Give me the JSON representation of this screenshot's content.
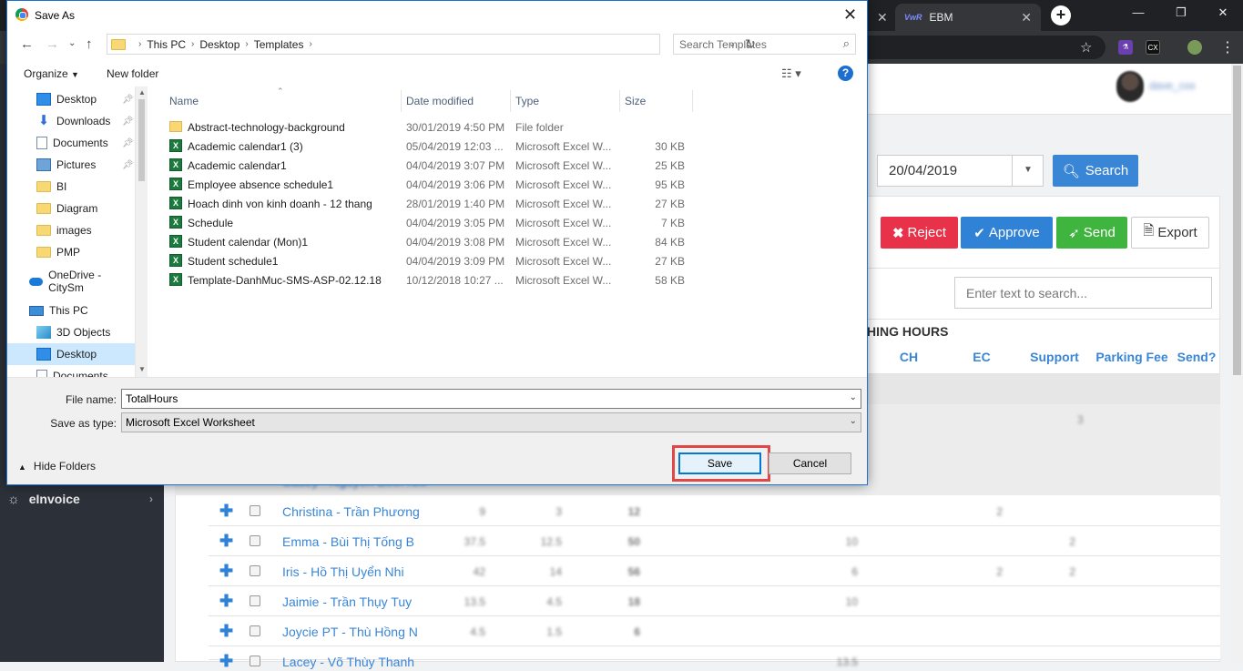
{
  "browser": {
    "tab_label": "EBM",
    "tab_logo_text": "VwR",
    "new_tab_symbol": "+",
    "ext_label": "CX"
  },
  "app": {
    "user_name": "dave_cxx",
    "sidebar": {
      "item_label": "eInvoice"
    },
    "date_value": "20/04/2019",
    "buttons": {
      "search": "Search",
      "reject": "Reject",
      "approve": "Approve",
      "send": "Send",
      "export": "Export"
    },
    "search_placeholder": "Enter text to search...",
    "group_header": "HING HOURS",
    "columns": [
      "CH",
      "EC",
      "Support",
      "Parking Fee",
      "Send?"
    ],
    "band_value": "3",
    "partial_row_name": "Casey - Nguyễn Bình Nhi",
    "rows": [
      {
        "name": "Christina - Trần Phương",
        "c1": "9",
        "c2": "3",
        "c3": "12",
        "c4": "",
        "c5": "2",
        "c6": ""
      },
      {
        "name": "Emma - Bùi Thị Tống B",
        "c1": "37.5",
        "c2": "12.5",
        "c3": "50",
        "c4": "10",
        "c5": "",
        "c6": "2"
      },
      {
        "name": "Iris - Hồ Thị Uyển Nhi",
        "c1": "42",
        "c2": "14",
        "c3": "56",
        "c4": "6",
        "c5": "2",
        "c6": "2"
      },
      {
        "name": "Jaimie - Trần Thụy Tuy",
        "c1": "13.5",
        "c2": "4.5",
        "c3": "18",
        "c4": "10",
        "c5": "",
        "c6": ""
      },
      {
        "name": "Joycie PT - Thù Hồng N",
        "c1": "4.5",
        "c2": "1.5",
        "c3": "6",
        "c4": "",
        "c5": "",
        "c6": ""
      },
      {
        "name": "Lacey - Võ Thùy Thanh",
        "c1": "",
        "c2": "",
        "c3": "",
        "c4": "13.5",
        "c5": "",
        "c6": ""
      }
    ]
  },
  "dialog": {
    "title": "Save As",
    "close_symbol": "✕",
    "breadcrumb": [
      "This PC",
      "Desktop",
      "Templates"
    ],
    "search_placeholder": "Search Templates",
    "toolbar": {
      "organize": "Organize",
      "new_folder": "New folder"
    },
    "nav_items": [
      {
        "label": "Desktop",
        "icon": "desktop-icon",
        "pinned": true
      },
      {
        "label": "Downloads",
        "icon": "downloads-icon",
        "pinned": true
      },
      {
        "label": "Documents",
        "icon": "documents-icon",
        "pinned": true
      },
      {
        "label": "Pictures",
        "icon": "pictures-icon",
        "pinned": true
      },
      {
        "label": "BI",
        "icon": "folder-icon",
        "pinned": false
      },
      {
        "label": "Diagram",
        "icon": "folder-icon",
        "pinned": false
      },
      {
        "label": "images",
        "icon": "folder-icon",
        "pinned": false
      },
      {
        "label": "PMP",
        "icon": "folder-icon",
        "pinned": false
      },
      {
        "label": "OneDrive - CitySm",
        "icon": "onedrive-icon",
        "pinned": false
      },
      {
        "label": "This PC",
        "icon": "this-pc-icon",
        "pinned": false
      },
      {
        "label": "3D Objects",
        "icon": "3d-objects-icon",
        "pinned": false
      },
      {
        "label": "Desktop",
        "icon": "desktop-icon",
        "pinned": false,
        "selected": true
      },
      {
        "label": "Documents",
        "icon": "documents-icon",
        "pinned": false
      }
    ],
    "columns": {
      "name": "Name",
      "date": "Date modified",
      "type": "Type",
      "size": "Size"
    },
    "files": [
      {
        "name": "Abstract-technology-background",
        "date": "30/01/2019 4:50 PM",
        "type": "File folder",
        "size": "",
        "kind": "folder"
      },
      {
        "name": "Academic calendar1 (3)",
        "date": "05/04/2019 12:03 ...",
        "type": "Microsoft Excel W...",
        "size": "30 KB",
        "kind": "excel"
      },
      {
        "name": "Academic calendar1",
        "date": "04/04/2019 3:07 PM",
        "type": "Microsoft Excel W...",
        "size": "25 KB",
        "kind": "excel"
      },
      {
        "name": "Employee absence schedule1",
        "date": "04/04/2019 3:06 PM",
        "type": "Microsoft Excel W...",
        "size": "95 KB",
        "kind": "excel"
      },
      {
        "name": "Hoach dinh von kinh doanh - 12 thang",
        "date": "28/01/2019 1:40 PM",
        "type": "Microsoft Excel W...",
        "size": "27 KB",
        "kind": "excel"
      },
      {
        "name": "Schedule",
        "date": "04/04/2019 3:05 PM",
        "type": "Microsoft Excel W...",
        "size": "7 KB",
        "kind": "excel"
      },
      {
        "name": "Student calendar (Mon)1",
        "date": "04/04/2019 3:08 PM",
        "type": "Microsoft Excel W...",
        "size": "84 KB",
        "kind": "excel"
      },
      {
        "name": "Student schedule1",
        "date": "04/04/2019 3:09 PM",
        "type": "Microsoft Excel W...",
        "size": "27 KB",
        "kind": "excel"
      },
      {
        "name": "Template-DanhMuc-SMS-ASP-02.12.18",
        "date": "10/12/2018 10:27 ...",
        "type": "Microsoft Excel W...",
        "size": "58 KB",
        "kind": "excel"
      }
    ],
    "file_name_label": "File name:",
    "file_name_value": "TotalHours",
    "save_type_label": "Save as type:",
    "save_type_value": "Microsoft Excel Worksheet",
    "hide_folders": "Hide Folders",
    "save_button": "Save",
    "cancel_button": "Cancel"
  }
}
